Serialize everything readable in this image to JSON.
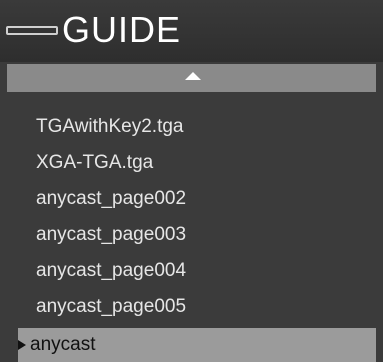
{
  "header": {
    "title": "GUIDE"
  },
  "list": {
    "items": [
      {
        "label": "TGAwithKey2.tga"
      },
      {
        "label": "XGA-TGA.tga"
      },
      {
        "label": "anycast_page002"
      },
      {
        "label": "anycast_page003"
      },
      {
        "label": "anycast_page004"
      },
      {
        "label": "anycast_page005"
      },
      {
        "label": "anycast",
        "selected": true
      }
    ]
  },
  "icons": {
    "header": "menu-bar-icon",
    "scroll": "triangle-up-icon",
    "selection": "triangle-right-icon"
  }
}
